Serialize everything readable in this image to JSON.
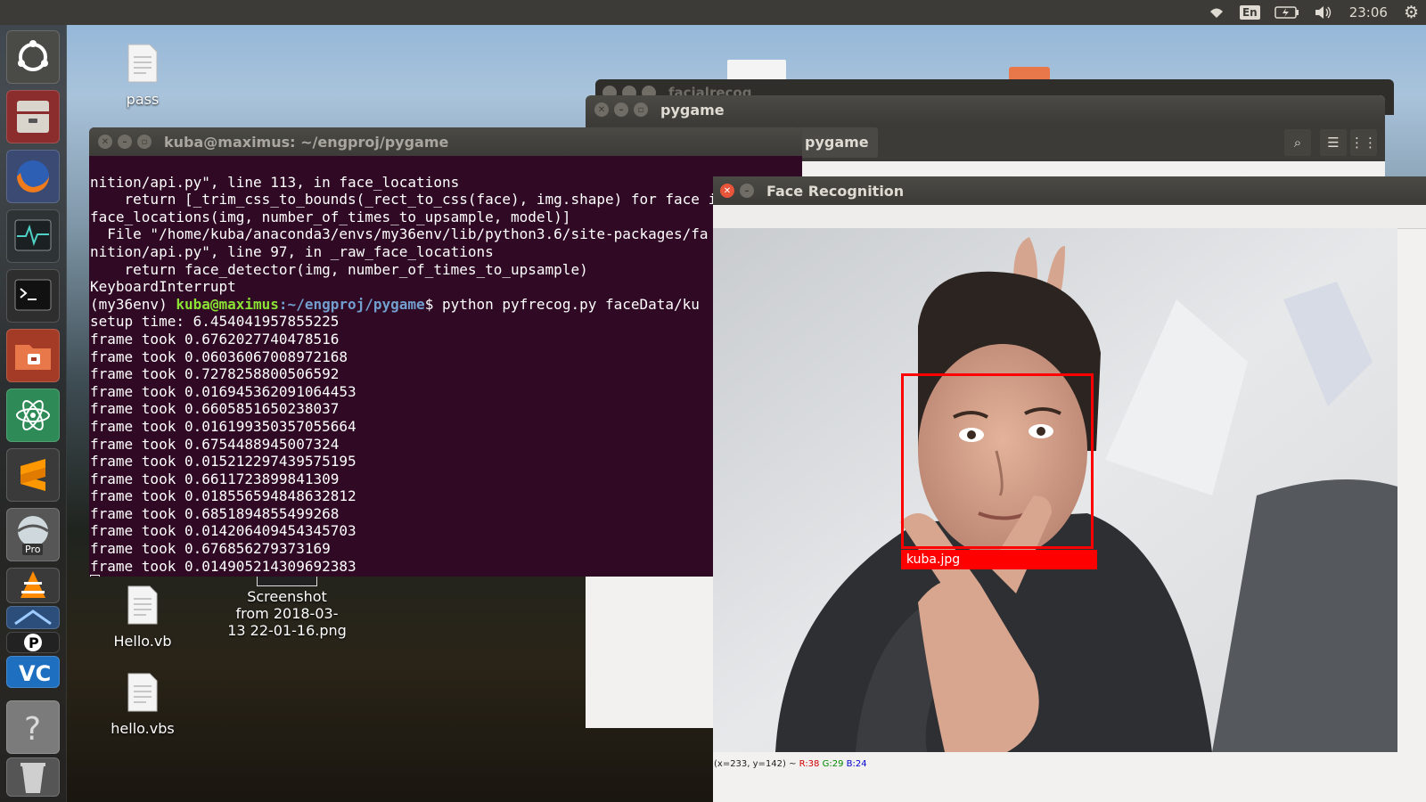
{
  "top_panel": {
    "language": "En",
    "clock": "23:06",
    "icons": [
      "wifi-icon",
      "keyboard-language-icon",
      "battery-icon",
      "volume-icon",
      "clock",
      "settings-gear-icon"
    ]
  },
  "launcher": {
    "items": [
      "ubuntu-dash-icon",
      "files-icon",
      "firefox-icon",
      "system-monitor-icon",
      "terminal-icon",
      "file-manager-icon",
      "atom-editor-icon",
      "sublime-text-icon",
      "google-earth-pro-icon",
      "vlc-icon",
      "python-ide-icon",
      "visual-studio-code-icon",
      "help-icon",
      "trash-icon"
    ],
    "earth_badge": "Pro"
  },
  "desktop_icons": [
    {
      "label": "pass"
    },
    {
      "label": "Hello.vb"
    },
    {
      "label": "hello.vbs"
    },
    {
      "label": "Screenshot\nfrom 2018-03-\n13 22-01-16.png"
    }
  ],
  "windows": {
    "facialrecog_title": "facialrecog",
    "pygame": {
      "title": "pygame",
      "path_button": "pygame"
    },
    "terminal": {
      "title": "kuba@maximus: ~/engproj/pygame",
      "lines_before_prompt": [
        "nition/api.py\", line 113, in face_locations",
        "    return [_trim_css_to_bounds(_rect_to_css(face), img.shape) for face i",
        "face_locations(img, number_of_times_to_upsample, model)]",
        "  File \"/home/kuba/anaconda3/envs/my36env/lib/python3.6/site-packages/fa",
        "nition/api.py\", line 97, in _raw_face_locations",
        "    return face_detector(img, number_of_times_to_upsample)",
        "KeyboardInterrupt"
      ],
      "prompt": {
        "env": "(my36env) ",
        "user_host": "kuba@maximus",
        "path": ":~/engproj/pygame",
        "command": "$ python pyfrecog.py faceData/ku"
      },
      "lines_after_prompt": [
        "setup time: 6.454041957855225",
        "frame took 0.6762027740478516",
        "frame took 0.06036067008972168",
        "frame took 0.7278258800506592",
        "frame took 0.016945362091064453",
        "frame took 0.6605851650238037",
        "frame took 0.016199350357055664",
        "frame took 0.6754488945007324",
        "frame took 0.015212297439575195",
        "frame took 0.6611723899841309",
        "frame took 0.018556594848632812",
        "frame took 0.6851894855499268",
        "frame took 0.014206409454345703",
        "frame took 0.676856279373169",
        "frame took 0.014905214309692383"
      ]
    },
    "face_recognition": {
      "title": "Face Recognition",
      "detected_label": "kuba.jpg",
      "status": {
        "coords": "(x=233, y=142) ~ ",
        "r": "R:38",
        "g": "G:29",
        "b": "B:24"
      }
    }
  }
}
